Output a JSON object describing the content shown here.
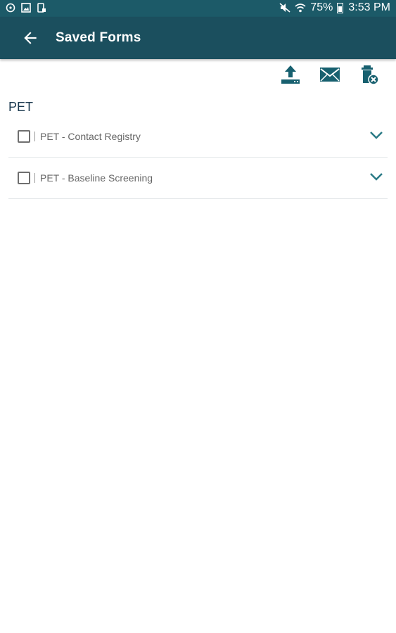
{
  "status_bar": {
    "battery": "75%",
    "time": "3:53 PM",
    "icons": [
      "alarm-icon",
      "image-icon",
      "lock-phone-icon",
      "mute-icon",
      "wifi-icon",
      "battery-icon"
    ]
  },
  "app_bar": {
    "title": "Saved Forms",
    "background": "#1b4f5e"
  },
  "toolbar": {
    "actions": [
      "upload-icon",
      "email-icon",
      "delete-icon"
    ],
    "icon_color": "#17606f"
  },
  "group": {
    "title": "PET",
    "items": [
      {
        "label": "PET - Contact Registry",
        "checked": false
      },
      {
        "label": "PET - Baseline Screening",
        "checked": false
      }
    ]
  }
}
